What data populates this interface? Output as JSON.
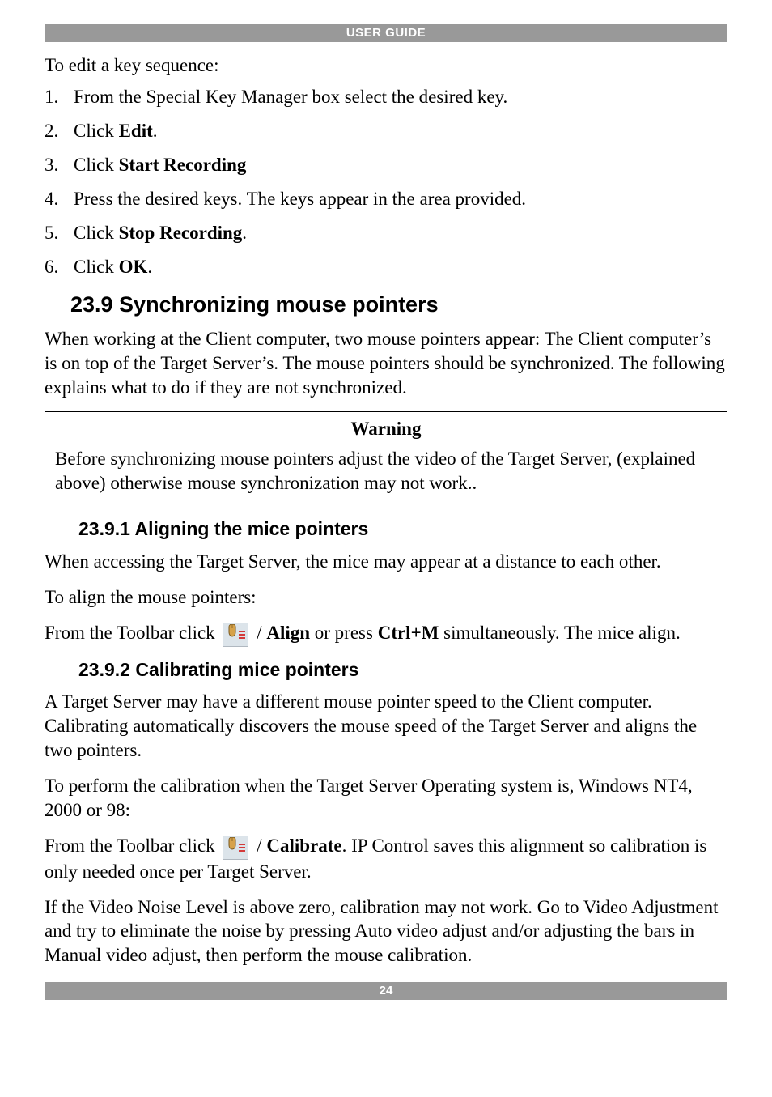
{
  "header": "USER GUIDE",
  "footer": "24",
  "introEdit": "To edit a key sequence:",
  "steps": [
    {
      "pre": "From the Special Key Manager box select the desired key.",
      "bold": "",
      "post": ""
    },
    {
      "pre": "Click ",
      "bold": "Edit",
      "post": "."
    },
    {
      "pre": "Click ",
      "bold": "Start Recording",
      "post": ""
    },
    {
      "pre": "Press the desired keys. The keys appear in the area provided.",
      "bold": "",
      "post": ""
    },
    {
      "pre": "Click ",
      "bold": "Stop Recording",
      "post": "."
    },
    {
      "pre": "Click ",
      "bold": "OK",
      "post": "."
    }
  ],
  "section239": {
    "title": "23.9 Synchronizing mouse pointers",
    "para1": "When working at the Client computer, two mouse pointers appear: The Client computer’s is on top of the Target Server’s. The mouse pointers should be synchronized. The following explains what to do if they are not synchronized."
  },
  "warning": {
    "title": "Warning",
    "body": "Before synchronizing mouse pointers adjust the video of the Target Server, (explained above) otherwise mouse synchronization may not work.."
  },
  "section2391": {
    "title": "23.9.1 Aligning the mice pointers",
    "para1": "When accessing the Target Server, the mice may appear at a distance to each other.",
    "para2": "To align the mouse pointers:",
    "align": {
      "pre": "From the Toolbar click ",
      "mid1": " / ",
      "bold1": "Align",
      "mid2": " or press ",
      "bold2": "Ctrl+M",
      "post": " simultaneously. The mice align."
    }
  },
  "section2392": {
    "title": "23.9.2 Calibrating mice pointers",
    "para1": "A Target Server may have a different mouse pointer speed to the Client computer. Calibrating automatically discovers the mouse speed of the Target Server and aligns the two pointers.",
    "para2": "To perform the calibration when the Target Server Operating system is, Windows NT4, 2000 or 98:",
    "calibrate": {
      "pre": "From the Toolbar click ",
      "mid": " / ",
      "bold": "Calibrate",
      "post": ". IP Control saves this alignment so calibration is only needed once per Target Server."
    },
    "para3": "If the Video Noise Level is above zero, calibration may not work. Go to Video Adjustment and try to eliminate the noise by pressing Auto video adjust and/or adjusting the bars in Manual video adjust, then perform the mouse calibration."
  },
  "iconName": "mouse-align-icon"
}
